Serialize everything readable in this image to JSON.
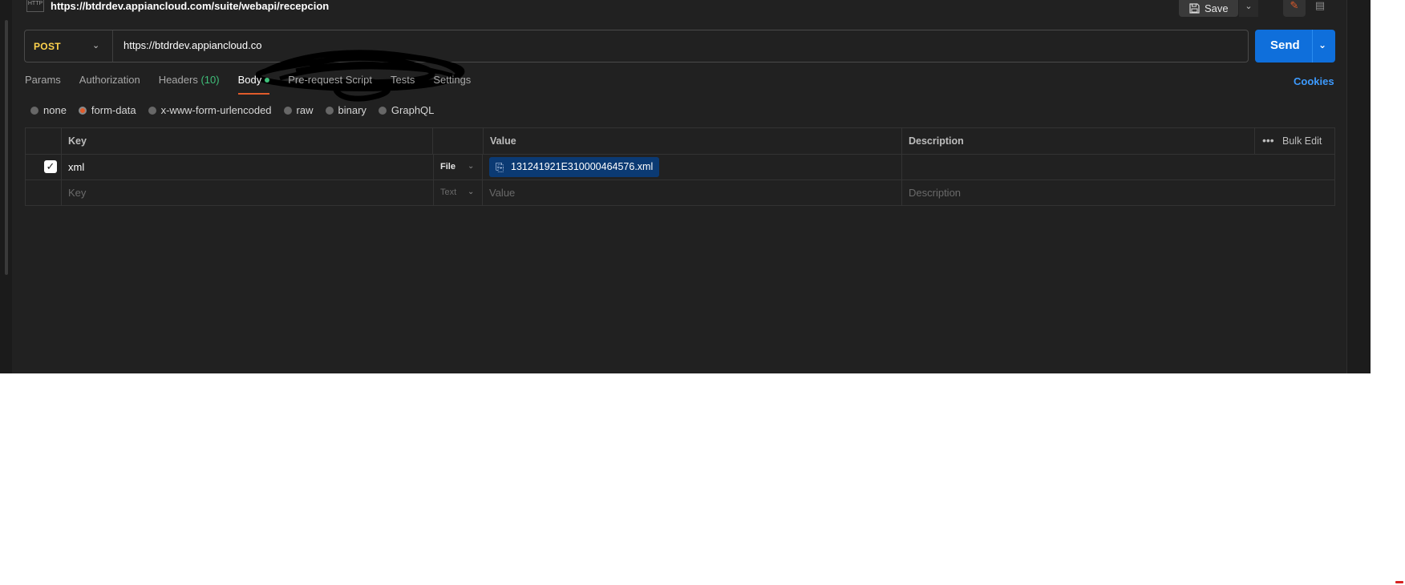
{
  "request": {
    "title": "https://btdrdev.appiancloud.com/suite/webapi/recepcion",
    "method": "POST",
    "url": "https://btdrdev.appiancloud.co"
  },
  "header_actions": {
    "save_label": "Save"
  },
  "send": {
    "label": "Send"
  },
  "tabs": [
    {
      "label": "Params"
    },
    {
      "label": "Authorization"
    },
    {
      "label": "Headers",
      "count": "(10)"
    },
    {
      "label": "Body",
      "active": true
    },
    {
      "label": "Pre-request Script"
    },
    {
      "label": "Tests"
    },
    {
      "label": "Settings"
    }
  ],
  "cookies_label": "Cookies",
  "body_types": [
    "none",
    "form-data",
    "x-www-form-urlencoded",
    "raw",
    "binary",
    "GraphQL"
  ],
  "body_type_selected": "form-data",
  "table": {
    "headers": {
      "key": "Key",
      "value": "Value",
      "description": "Description",
      "bulk_edit": "Bulk Edit"
    },
    "rows": [
      {
        "checked": true,
        "key": "xml",
        "type": "File",
        "value": "131241921E310000464576.xml",
        "description": ""
      }
    ],
    "empty_row": {
      "key_placeholder": "Key",
      "type": "Text",
      "value_placeholder": "Value",
      "description_placeholder": "Description"
    }
  },
  "colors": {
    "accent": "#e05b2b",
    "send_blue": "#0f6fdb",
    "method_yellow": "#ffd34d",
    "success_green": "#3fbf7a",
    "link_blue": "#3d9bff"
  },
  "icons": [
    "http-request-icon",
    "save-icon",
    "chevron-down-icon",
    "edit-icon",
    "comment-icon",
    "code-icon",
    "more-horizontal-icon",
    "file-icon",
    "check-icon"
  ]
}
